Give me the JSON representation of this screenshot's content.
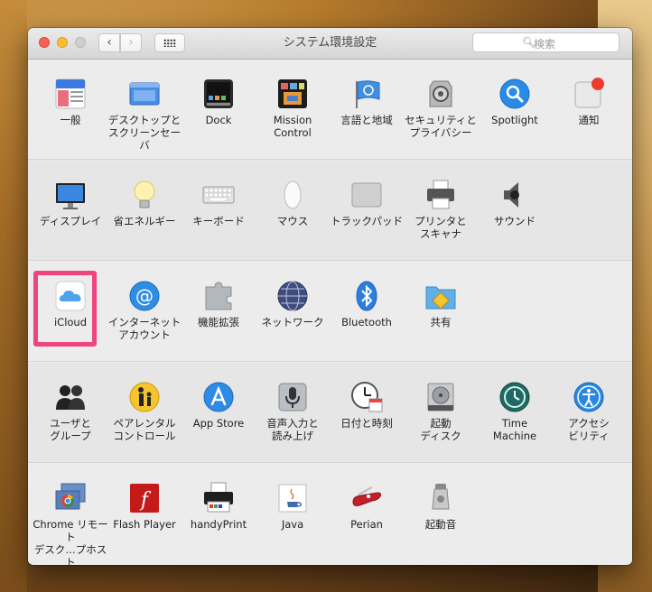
{
  "window": {
    "title": "システム環境設定"
  },
  "search": {
    "placeholder": "検索",
    "icon": "magnifier-icon"
  },
  "nav": {
    "back": "‹",
    "forward": "›"
  },
  "rows": [
    [
      {
        "label": "一般",
        "icon": "general-icon"
      },
      {
        "label": "デスクトップと\nスクリーンセーバ",
        "icon": "desktop-icon"
      },
      {
        "label": "Dock",
        "icon": "dock-icon"
      },
      {
        "label": "Mission\nControl",
        "icon": "mission-control-icon"
      },
      {
        "label": "言語と地域",
        "icon": "language-region-icon"
      },
      {
        "label": "セキュリティと\nプライバシー",
        "icon": "security-icon"
      },
      {
        "label": "Spotlight",
        "icon": "spotlight-icon"
      },
      {
        "label": "通知",
        "icon": "notifications-icon"
      }
    ],
    [
      {
        "label": "ディスプレイ",
        "icon": "display-icon"
      },
      {
        "label": "省エネルギー",
        "icon": "energy-saver-icon"
      },
      {
        "label": "キーボード",
        "icon": "keyboard-icon"
      },
      {
        "label": "マウス",
        "icon": "mouse-icon"
      },
      {
        "label": "トラックパッド",
        "icon": "trackpad-icon"
      },
      {
        "label": "プリンタと\nスキャナ",
        "icon": "printer-icon"
      },
      {
        "label": "サウンド",
        "icon": "sound-icon"
      }
    ],
    [
      {
        "label": "iCloud",
        "icon": "icloud-icon",
        "highlighted": true
      },
      {
        "label": "インターネット\nアカウント",
        "icon": "internet-accounts-icon"
      },
      {
        "label": "機能拡張",
        "icon": "extensions-icon"
      },
      {
        "label": "ネットワーク",
        "icon": "network-icon"
      },
      {
        "label": "Bluetooth",
        "icon": "bluetooth-icon"
      },
      {
        "label": "共有",
        "icon": "sharing-icon"
      }
    ],
    [
      {
        "label": "ユーザと\nグループ",
        "icon": "users-groups-icon"
      },
      {
        "label": "ペアレンタル\nコントロール",
        "icon": "parental-controls-icon"
      },
      {
        "label": "App Store",
        "icon": "app-store-icon"
      },
      {
        "label": "音声入力と\n読み上げ",
        "icon": "dictation-speech-icon"
      },
      {
        "label": "日付と時刻",
        "icon": "date-time-icon"
      },
      {
        "label": "起動\nディスク",
        "icon": "startup-disk-icon"
      },
      {
        "label": "Time\nMachine",
        "icon": "time-machine-icon"
      },
      {
        "label": "アクセシ\nビリティ",
        "icon": "accessibility-icon"
      }
    ],
    [
      {
        "label": "Chrome リモート\nデスク…プホスト",
        "icon": "chrome-remote-desktop-icon"
      },
      {
        "label": "Flash Player",
        "icon": "flash-player-icon"
      },
      {
        "label": "handyPrint",
        "icon": "handyprint-icon"
      },
      {
        "label": "Java",
        "icon": "java-icon"
      },
      {
        "label": "Perian",
        "icon": "perian-icon"
      },
      {
        "label": "起動音",
        "icon": "startup-sound-icon"
      }
    ]
  ]
}
